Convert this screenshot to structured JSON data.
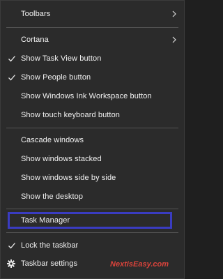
{
  "menu": {
    "toolbars": {
      "label": "Toolbars"
    },
    "cortana": {
      "label": "Cortana"
    },
    "show_task_view": {
      "label": "Show Task View button",
      "checked": true
    },
    "show_people": {
      "label": "Show People button",
      "checked": true
    },
    "show_ink_workspace": {
      "label": "Show Windows Ink Workspace button",
      "checked": false
    },
    "show_touch_keyboard": {
      "label": "Show touch keyboard button",
      "checked": false
    },
    "cascade": {
      "label": "Cascade windows"
    },
    "stacked": {
      "label": "Show windows stacked"
    },
    "side_by_side": {
      "label": "Show windows side by side"
    },
    "show_desktop": {
      "label": "Show the desktop"
    },
    "task_manager": {
      "label": "Task Manager"
    },
    "lock_taskbar": {
      "label": "Lock the taskbar",
      "checked": true
    },
    "taskbar_settings": {
      "label": "Taskbar settings"
    }
  },
  "watermark": "NextisEasy.com",
  "colors": {
    "menu_bg": "#2b2b2b",
    "text": "#f2f2f2",
    "separator": "#545454",
    "highlight_border": "#3a3cc1",
    "watermark": "#d9433b"
  }
}
